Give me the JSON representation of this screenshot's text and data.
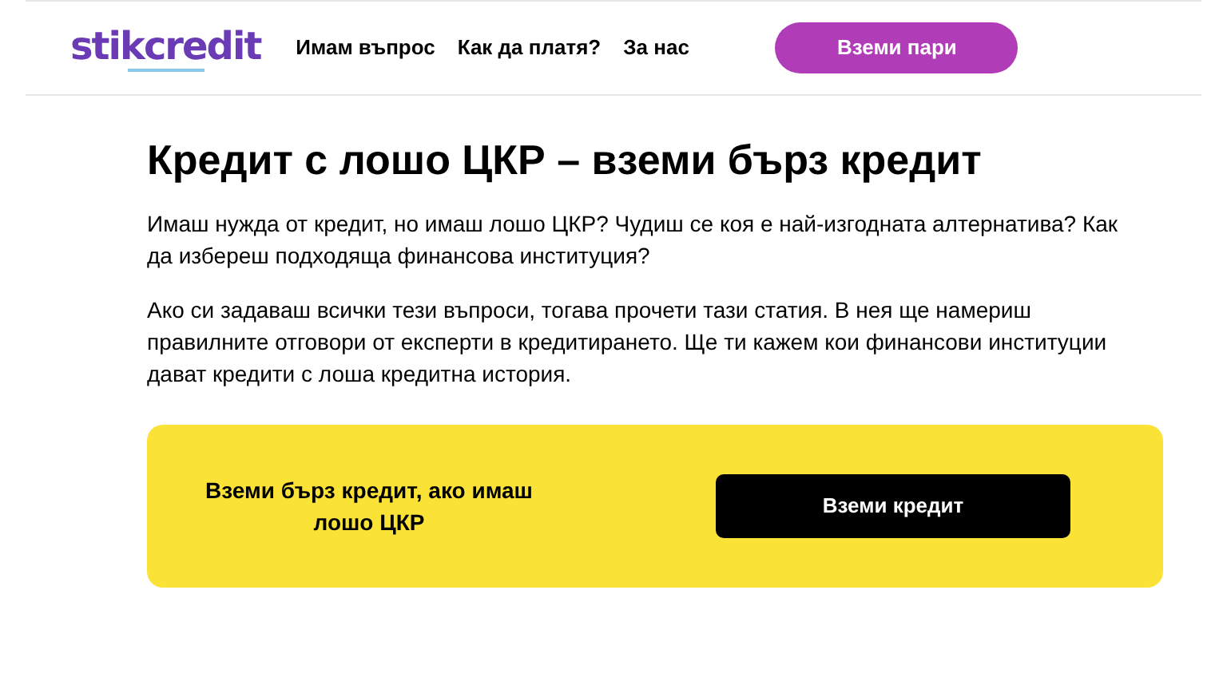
{
  "header": {
    "logo": "stikcredit",
    "nav": [
      "Имам въпрос",
      "Как да платя?",
      "За нас"
    ],
    "cta": "Вземи пари"
  },
  "article": {
    "title": "Кредит с лошо ЦКР – вземи бърз кредит",
    "paragraphs": [
      "Имаш нужда от кредит, но имаш лошо ЦКР? Чудиш се коя е най-изгодната алтернатива? Как да избереш подходяща финансова институция?",
      "Ако си задаваш всички тези въпроси, тогава прочети тази статия. В нея ще намериш правилните отговори от експерти в кредитирането. Ще ти кажем кои финансови институции дават кредити с лоша кредитна история."
    ]
  },
  "banner": {
    "text": "Вземи бърз кредит, ако имаш лошо ЦКР",
    "button": "Вземи кредит"
  }
}
